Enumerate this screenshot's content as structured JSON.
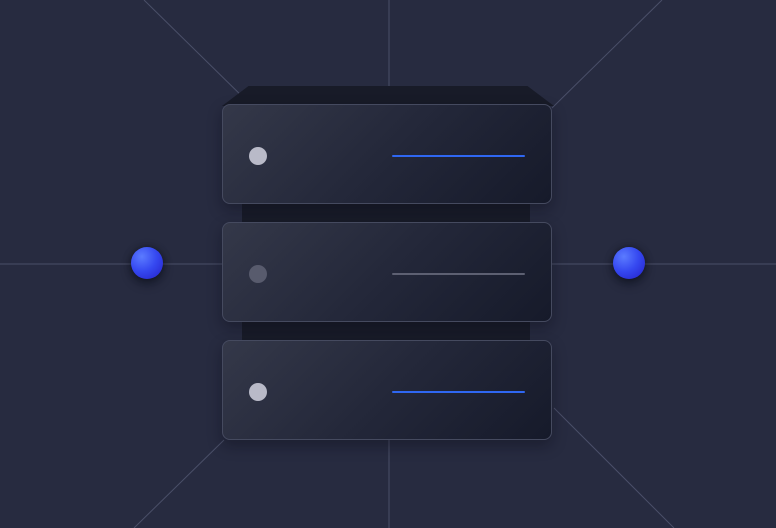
{
  "scene": {
    "icon": "server-rack-network-illustration",
    "servers": [
      {
        "status": "on",
        "activity": "active"
      },
      {
        "status": "off",
        "activity": "idle"
      },
      {
        "status": "on",
        "activity": "active"
      }
    ],
    "nodes": [
      {
        "icon": "network-node-icon",
        "side": "left"
      },
      {
        "icon": "network-node-icon",
        "side": "right"
      }
    ],
    "colors": {
      "background": "#272b40",
      "connection_line": "#4a4f68",
      "server_border": "#454a5f",
      "active_indicator": "#2f67f2",
      "idle_indicator": "#5d6072",
      "led_on": "#b9bac8",
      "led_off": "#585b6d",
      "node": "#3548f0"
    }
  }
}
